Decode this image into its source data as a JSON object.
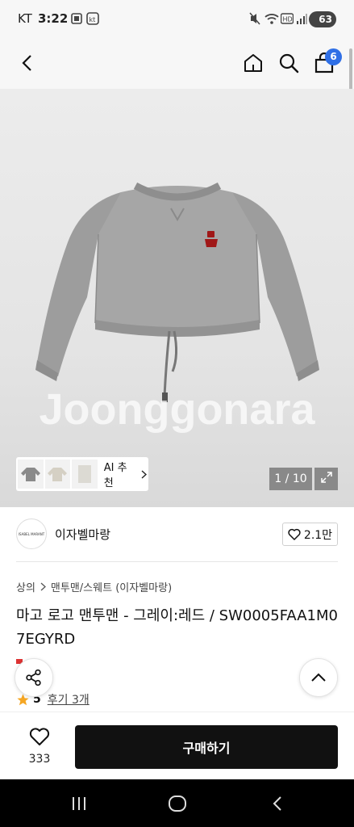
{
  "status_bar": {
    "carrier": "KT",
    "time": "3:22",
    "battery": "63"
  },
  "nav": {
    "cart_count": "6"
  },
  "gallery": {
    "watermark": "Joonggonara",
    "ai_label": "AI 추천",
    "page_indicator": "1 / 10"
  },
  "shop": {
    "name": "이자벨마랑",
    "logo_text": "ISABEL MARANT",
    "like_count": "2.1만"
  },
  "breadcrumb": {
    "level1": "상의",
    "level2": "맨투맨/스웨트 (이자벨마랑)"
  },
  "product": {
    "title": "마고 로고 맨투맨 - 그레이:레드 / SW0005FAA1M07EGYRD",
    "rating": "5",
    "reviews": "후기 3개"
  },
  "bottom_bar": {
    "wish_count": "333",
    "buy_label": "구매하기"
  },
  "colors": {
    "accent_badge": "#2f6fe6",
    "buy_button": "#111111",
    "star": "#f5a623",
    "logo_red": "#a01818"
  }
}
